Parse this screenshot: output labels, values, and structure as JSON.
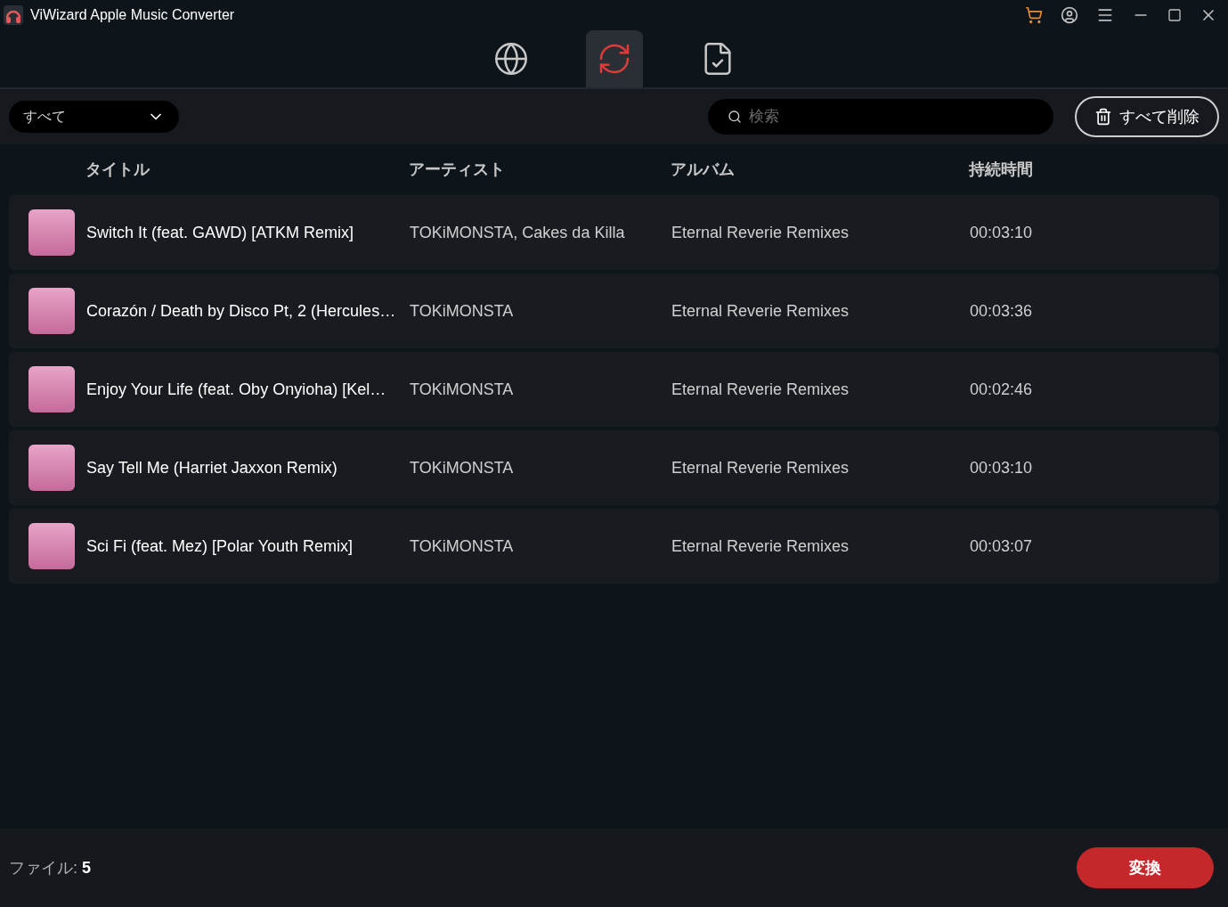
{
  "window": {
    "title": "ViWizard Apple Music Converter"
  },
  "tabs": [
    {
      "kind": "globe",
      "selected": false
    },
    {
      "kind": "convert",
      "selected": true
    },
    {
      "kind": "done",
      "selected": false
    }
  ],
  "filter": {
    "value": "すべて"
  },
  "search": {
    "placeholder": "検索"
  },
  "delete_all_button": "すべて削除",
  "table": {
    "columns": [
      "タイトル",
      "アーティスト",
      "アルバム",
      "持続時間"
    ],
    "rows": [
      {
        "title": "Switch It (feat. GAWD) [ATKM Remix]",
        "artist": "TOKiMONSTA, Cakes da Killa",
        "album": "Eternal Reverie Remixes",
        "duration": "00:03:10"
      },
      {
        "title": "Corazón / Death by Disco Pt, 2 (Hercules…",
        "artist": "TOKiMONSTA",
        "album": "Eternal Reverie Remixes",
        "duration": "00:03:36"
      },
      {
        "title": "Enjoy Your Life (feat. Oby Onyioha) [Kel…",
        "artist": "TOKiMONSTA",
        "album": "Eternal Reverie Remixes",
        "duration": "00:02:46"
      },
      {
        "title": "Say Tell Me (Harriet Jaxxon Remix)",
        "artist": "TOKiMONSTA",
        "album": "Eternal Reverie Remixes",
        "duration": "00:03:10"
      },
      {
        "title": "Sci Fi (feat. Mez) [Polar Youth Remix]",
        "artist": "TOKiMONSTA",
        "album": "Eternal Reverie Remixes",
        "duration": "00:03:07"
      }
    ]
  },
  "status_bar": {
    "file_count": "ファイル: **5**",
    "convert_button": "変換"
  }
}
